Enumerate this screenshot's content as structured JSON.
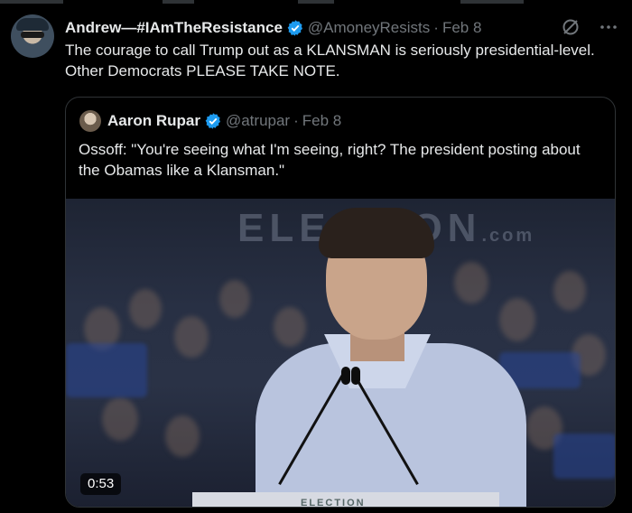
{
  "tweet": {
    "author_name": "Andrew—#IAmTheResistance",
    "handle": "@AmoneyResists",
    "separator": "·",
    "date": "Feb 8",
    "text": "The courage to call Trump out as a KLANSMAN is seriously presidential-level. Other Democrats PLEASE TAKE NOTE.",
    "verified": true
  },
  "quoted_tweet": {
    "author_name": "Aaron Rupar",
    "handle": "@atrupar",
    "separator": "·",
    "date": "Feb 8",
    "text": "Ossoff: \"You're seeing what I'm seeing, right? The president posting about the Obamas like a Klansman.\"",
    "verified": true,
    "video": {
      "duration": "0:53",
      "background_sign": "ELECTION",
      "background_sign_suffix": ".com",
      "podium_text": "ELECTION"
    }
  },
  "icons": {
    "verified": "verified-badge-icon",
    "grok": "grok-icon",
    "more": "more-options-icon"
  },
  "colors": {
    "background": "#000000",
    "text": "#e7e9ea",
    "secondary_text": "#71767b",
    "verified_blue": "#1d9bf0",
    "border": "#2f3336"
  }
}
